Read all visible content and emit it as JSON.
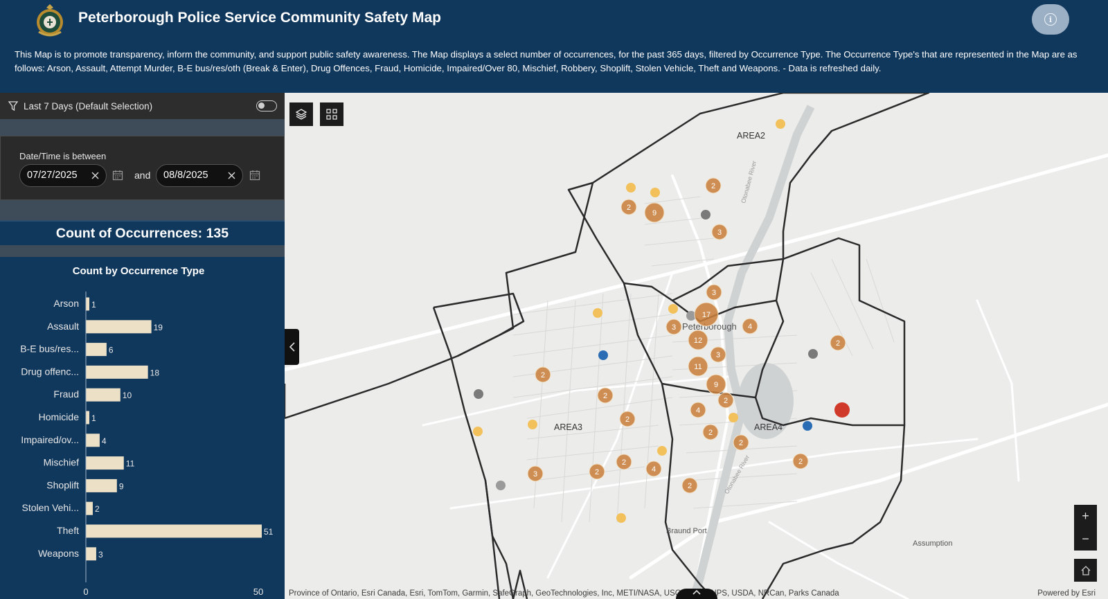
{
  "header": {
    "title": "Peterborough Police Service Community Safety Map",
    "info_icon": "info-icon",
    "logo_icon": "police-crest-logo"
  },
  "description": "This Map is to promote transparency, inform the community, and support public safety awareness. The Map displays a select number of occurrences, for the past 365 days, filtered by Occurrence Type. The Occurrence Type's that are represented in the Map are as follows: Arson, Assault, Attempt Murder, B-E bus/res/oth (Break & Enter), Drug Offences, Fraud, Homicide, Impaired/Over 80, Mischief, Robbery, Shoplift, Stolen Vehicle, Theft and Weapons. - Data is refreshed daily.",
  "filter": {
    "label": "Last 7 Days (Default Selection)",
    "toggle_on": false
  },
  "date_filter": {
    "label": "Date/Time is between",
    "start": "07/27/2025",
    "end": "08/8/2025",
    "and_label": "and"
  },
  "count": {
    "text": "Count of Occurrences: 135"
  },
  "chart_data": {
    "type": "bar",
    "orientation": "horizontal",
    "title": "Count by Occurrence Type",
    "categories": [
      "Arson",
      "Assault",
      "B-E bus/res...",
      "Drug offenc...",
      "Fraud",
      "Homicide",
      "Impaired/ov...",
      "Mischief",
      "Shoplift",
      "Stolen Vehi...",
      "Theft",
      "Weapons"
    ],
    "values": [
      1,
      19,
      6,
      18,
      10,
      1,
      4,
      11,
      9,
      2,
      51,
      3
    ],
    "ticks": [
      "0",
      "50"
    ],
    "xlim": [
      0,
      51
    ],
    "bar_color": "#ece0c6",
    "grid": false
  },
  "map": {
    "area_labels": [
      "AREA2",
      "AREA3",
      "AREA4"
    ],
    "place_labels": [
      "Peterborough",
      "Braund Port",
      "Assumption"
    ],
    "road_labels": [
      "Otonabee River",
      "Otonabee River"
    ],
    "clusters": [
      "2",
      "2",
      "9",
      "3",
      "3",
      "17",
      "3",
      "4",
      "12",
      "3",
      "11",
      "2",
      "2",
      "2",
      "9",
      "2",
      "2",
      "4",
      "2",
      "3",
      "2",
      "2",
      "4",
      "2",
      "2",
      "2"
    ],
    "cluster_color": "#c9813e",
    "layers_icon": "layers-icon",
    "legend_icon": "legend-grid-icon",
    "zoom_in": "+",
    "zoom_out": "−",
    "home_icon": "home-icon",
    "attribution": "Province of Ontario, Esri Canada, Esri, TomTom, Garmin, SafeGraph, GeoTechnologies, Inc, METI/NASA, USGS, EPA, NPS, USDA, NRCan, Parks Canada",
    "powered": "Powered by Esri"
  }
}
